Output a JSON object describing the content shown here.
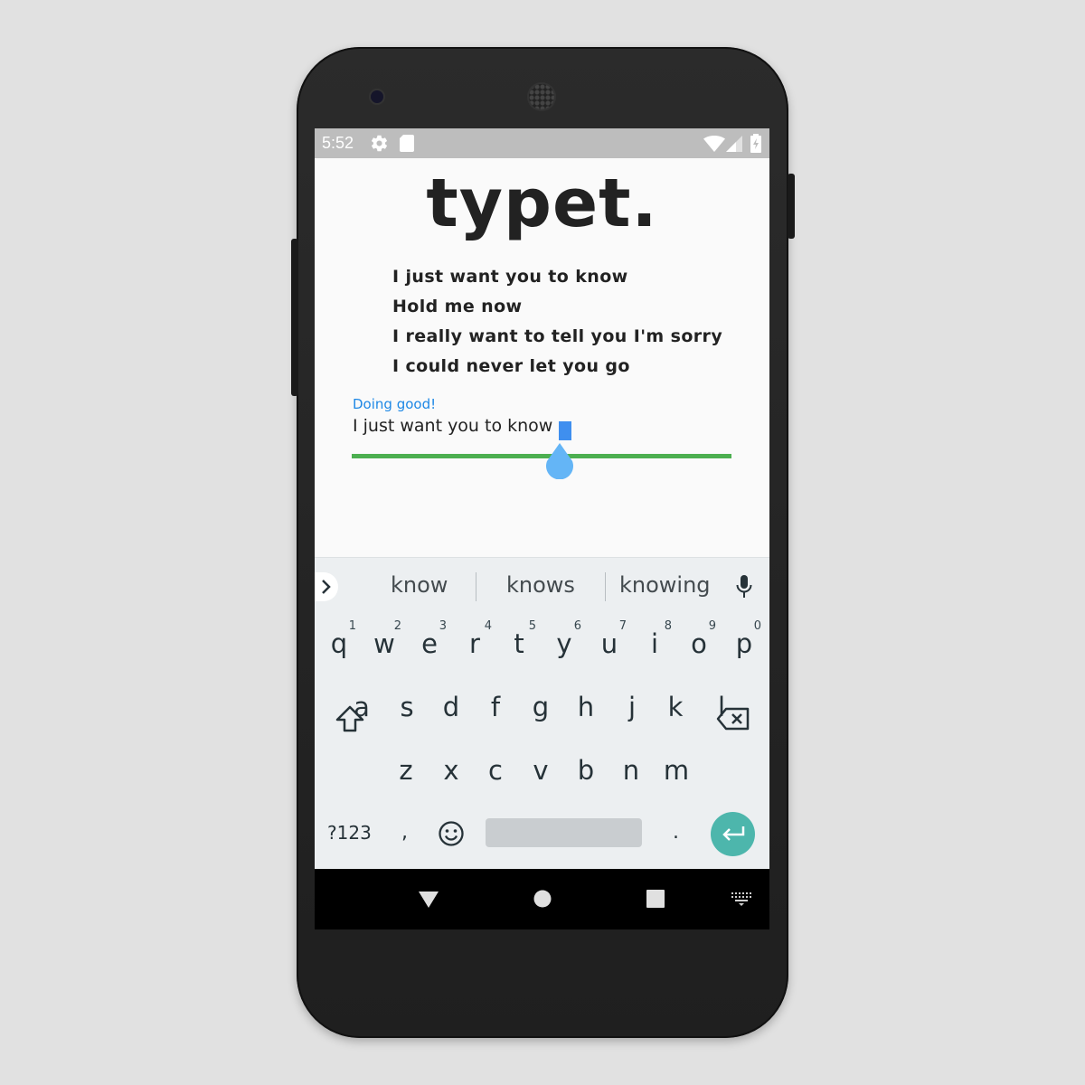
{
  "status_bar": {
    "time": "5:52",
    "left_icons": [
      "gear-icon",
      "sd-card-icon"
    ],
    "right_icons": [
      "wifi-icon",
      "signal-icon",
      "battery-charging-icon"
    ]
  },
  "app": {
    "title": "typet.",
    "lyrics": [
      "I just want you to know",
      "Hold me now",
      "I really want to tell you I'm sorry",
      "I could never let you go"
    ],
    "status_message": "Doing good!",
    "input_text": "I just want you to know",
    "colors": {
      "status": "#1e88e5",
      "progress_line": "#4caf50",
      "cursor": "#3f8fef",
      "handle": "#64b5f6"
    }
  },
  "keyboard": {
    "suggestions": [
      "know",
      "knows",
      "knowing"
    ],
    "rows": [
      [
        {
          "key": "q",
          "hint": "1"
        },
        {
          "key": "w",
          "hint": "2"
        },
        {
          "key": "e",
          "hint": "3"
        },
        {
          "key": "r",
          "hint": "4"
        },
        {
          "key": "t",
          "hint": "5"
        },
        {
          "key": "y",
          "hint": "6"
        },
        {
          "key": "u",
          "hint": "7"
        },
        {
          "key": "i",
          "hint": "8"
        },
        {
          "key": "o",
          "hint": "9"
        },
        {
          "key": "p",
          "hint": "0"
        }
      ],
      [
        "a",
        "s",
        "d",
        "f",
        "g",
        "h",
        "j",
        "k",
        "l"
      ],
      [
        "z",
        "x",
        "c",
        "v",
        "b",
        "n",
        "m"
      ]
    ],
    "symbols_label": "?123",
    "comma": ",",
    "period": ".",
    "icons": [
      "chevron-right-icon",
      "mic-icon",
      "shift-icon",
      "backspace-icon",
      "emoji-icon",
      "enter-icon"
    ],
    "enter_color": "#4db6ac"
  },
  "nav_bar": {
    "icons": [
      "back-icon",
      "home-icon",
      "recents-icon",
      "keyboard-switch-icon"
    ]
  }
}
